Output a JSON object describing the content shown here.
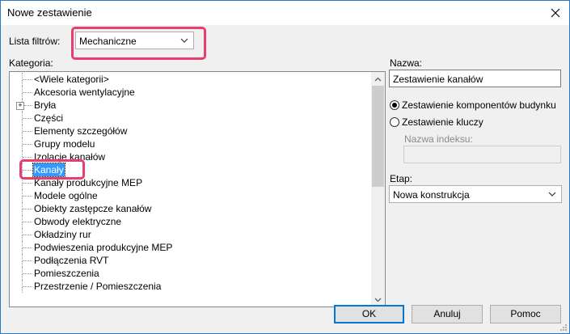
{
  "window": {
    "title": "Nowe zestawienie"
  },
  "filter": {
    "label": "Lista filtrów:",
    "value": "Mechaniczne"
  },
  "category": {
    "label": "Kategoria:",
    "items": [
      "<Wiele kategorii>",
      "Akcesoria wentylacyjne",
      "Bryła",
      "Części",
      "Elementy szczegółów",
      "Grupy modelu",
      "Izolacje kanałów",
      "Kanały",
      "Kanały produkcyjne MEP",
      "Modele ogólne",
      "Obiekty zastępcze kanałów",
      "Obwody elektryczne",
      "Okładziny rur",
      "Podwieszenia produkcyjne MEP",
      "Podłączenia RVT",
      "Pomieszczenia",
      "Przestrzenie / Pomieszczenia"
    ],
    "selected": "Kanały",
    "expandable": "Bryła"
  },
  "name": {
    "label": "Nazwa:",
    "value": "Zestawienie kanałów"
  },
  "options": {
    "building_components": "Zestawienie komponentów budynku",
    "key_schedule": "Zestawienie kluczy",
    "key_name_label": "Nazwa indeksu:",
    "key_name_value": "",
    "selected": "building_components"
  },
  "phase": {
    "label": "Etap:",
    "value": "Nowa konstrukcja"
  },
  "buttons": {
    "ok": "OK",
    "cancel": "Anuluj",
    "help": "Pomoc"
  },
  "colors": {
    "highlight": "#ea3d6f",
    "selection": "#3399ff",
    "accent": "#0078d7"
  }
}
